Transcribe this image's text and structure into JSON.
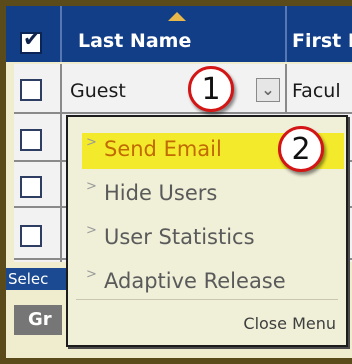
{
  "header": {
    "col_last_name": "Last Name",
    "col_first_name": "First I"
  },
  "rows": [
    {
      "last_name": "Guest",
      "first_name": "Facul"
    }
  ],
  "footer": {
    "select_label": "Selec",
    "grid_button": "Gr"
  },
  "menu": {
    "items": [
      {
        "label": "Send Email",
        "active": true
      },
      {
        "label": "Hide Users"
      },
      {
        "label": "User Statistics"
      },
      {
        "label": "Adaptive Release"
      }
    ],
    "close_label": "Close Menu"
  },
  "callouts": [
    "1",
    "2"
  ],
  "colors": {
    "header_bg": "#123e87",
    "menu_bg": "#f0efd8",
    "highlight": "#f4ea2c",
    "callout_border": "#d41515"
  }
}
